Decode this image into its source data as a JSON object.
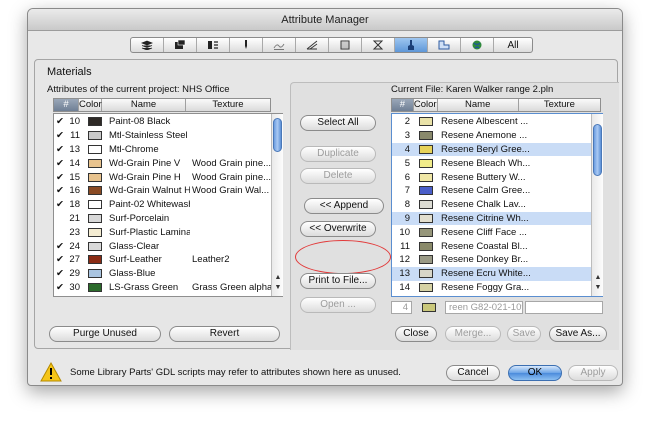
{
  "window": {
    "title": "Attribute Manager"
  },
  "tabs": {
    "items": [
      {
        "name": "layers-icon"
      },
      {
        "name": "pens-icon"
      },
      {
        "name": "linetypes-icon"
      },
      {
        "name": "fill-icon"
      },
      {
        "name": "composites-icon"
      },
      {
        "name": "profiles-icon"
      },
      {
        "name": "zones-icon"
      },
      {
        "name": "markup-icon"
      },
      {
        "name": "materials-icon"
      },
      {
        "name": "operation-profiles-icon"
      },
      {
        "name": "cities-icon"
      }
    ],
    "all_label": "All"
  },
  "section_title": "Materials",
  "left": {
    "caption": "Attributes of the current project: NHS Office",
    "headers": {
      "num": "#",
      "color": "Color",
      "name": "Name",
      "texture": "Texture"
    },
    "rows": [
      {
        "check": "✔",
        "num": "10",
        "color": "#2e2a26",
        "name": "Paint-08 Black",
        "texture": ""
      },
      {
        "check": "✔",
        "num": "11",
        "color": "#c9c9c9",
        "name": "Mtl-Stainless Steel",
        "texture": ""
      },
      {
        "check": "✔",
        "num": "13",
        "color": "#ffffff",
        "name": "Mtl-Chrome",
        "texture": ""
      },
      {
        "check": "✔",
        "num": "14",
        "color": "#e8c38e",
        "name": "Wd-Grain Pine V",
        "texture": "Wood Grain pine..."
      },
      {
        "check": "✔",
        "num": "15",
        "color": "#e8c38e",
        "name": "Wd-Grain Pine H",
        "texture": "Wood Grain pine..."
      },
      {
        "check": "✔",
        "num": "16",
        "color": "#8a4a23",
        "name": "Wd-Grain Walnut H",
        "texture": "Wood Grain Wal..."
      },
      {
        "check": "✔",
        "num": "18",
        "color": "#ffffff",
        "name": "Paint-02 Whitewash",
        "texture": ""
      },
      {
        "check": "",
        "num": "21",
        "color": "#d8d8d8",
        "name": "Surf-Porcelain",
        "texture": ""
      },
      {
        "check": "",
        "num": "23",
        "color": "#f4ecd2",
        "name": "Surf-Plastic Laminate",
        "texture": ""
      },
      {
        "check": "✔",
        "num": "24",
        "color": "#d9d9d9",
        "name": "Glass-Clear",
        "texture": ""
      },
      {
        "check": "✔",
        "num": "27",
        "color": "#8a2b14",
        "name": "Surf-Leather",
        "texture": "Leather2"
      },
      {
        "check": "✔",
        "num": "29",
        "color": "#a9c4e0",
        "name": "Glass-Blue",
        "texture": ""
      },
      {
        "check": "✔",
        "num": "30",
        "color": "#2b6a2b",
        "name": "LS-Grass Green",
        "texture": "Grass Green alpha"
      }
    ],
    "purge_label": "Purge Unused",
    "revert_label": "Revert"
  },
  "middle": {
    "select_all": "Select All",
    "duplicate": "Duplicate",
    "delete": "Delete",
    "append": "<< Append",
    "overwrite": "<< Overwrite",
    "print": "Print to File...",
    "open": "Open ..."
  },
  "right": {
    "caption": "Current File: Karen Walker range 2.pln",
    "headers": {
      "num": "#",
      "color": "Color",
      "name": "Name",
      "texture": "Texture"
    },
    "rows": [
      {
        "num": "2",
        "color": "#e9e2a8",
        "name": "Resene Albescent ...",
        "sel": false
      },
      {
        "num": "3",
        "color": "#8a8a6c",
        "name": "Resene Anemone ...",
        "sel": false
      },
      {
        "num": "4",
        "color": "#e7d35a",
        "name": "Resene Beryl Gree...",
        "sel": true
      },
      {
        "num": "5",
        "color": "#f1ec8a",
        "name": "Resene Bleach Wh...",
        "sel": false
      },
      {
        "num": "6",
        "color": "#f0e7a6",
        "name": "Resene Buttery W...",
        "sel": false
      },
      {
        "num": "7",
        "color": "#4a5ec9",
        "name": "Resene Calm Gree...",
        "sel": false
      },
      {
        "num": "8",
        "color": "#dcdcd4",
        "name": "Resene Chalk Lav...",
        "sel": false
      },
      {
        "num": "9",
        "color": "#e3dfcf",
        "name": "Resene Citrine Wh...",
        "sel": true
      },
      {
        "num": "10",
        "color": "#96967a",
        "name": "Resene Cliff Face ...",
        "sel": false
      },
      {
        "num": "11",
        "color": "#8a8a6a",
        "name": "Resene Coastal Bl...",
        "sel": false
      },
      {
        "num": "12",
        "color": "#9a9a86",
        "name": "Resene Donkey Br...",
        "sel": false
      },
      {
        "num": "13",
        "color": "#d8d6c8",
        "name": "Resene Ecru White...",
        "sel": true
      },
      {
        "num": "14",
        "color": "#d6d2a4",
        "name": "Resene Foggy Gra...",
        "sel": false
      }
    ],
    "edit_num": "4",
    "edit_color": "#c9c77a",
    "edit_name": "reen G82-021-109",
    "close": "Close",
    "merge": "Merge...",
    "save": "Save",
    "save_as": "Save As..."
  },
  "footer": {
    "warning": "Some Library Parts' GDL scripts may refer to attributes shown here as unused.",
    "cancel": "Cancel",
    "ok": "OK",
    "apply": "Apply"
  }
}
